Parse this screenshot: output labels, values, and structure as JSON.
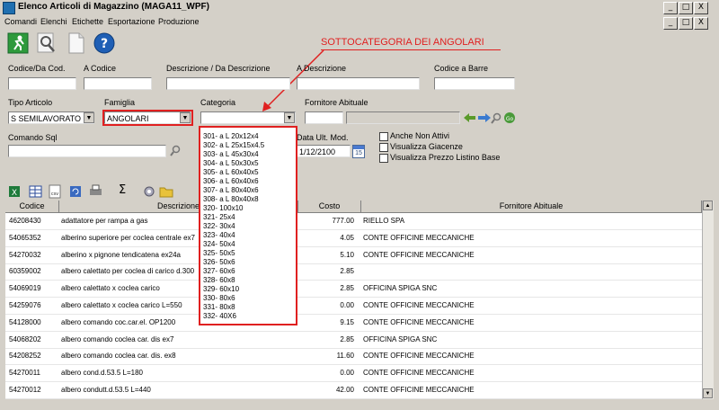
{
  "window": {
    "title": "Elenco Articoli di Magazzino (MAGA11_WPF)",
    "controls": [
      "_",
      "□",
      "X"
    ],
    "outer_controls": [
      "_",
      "□",
      "X"
    ]
  },
  "menu": [
    "Comandi",
    "Elenchi",
    "Etichette",
    "Esportazione",
    "Produzione"
  ],
  "toolbar": [
    {
      "icon": "exit-icon"
    },
    {
      "icon": "search-icon"
    },
    {
      "icon": "new-document-icon"
    },
    {
      "icon": "help-icon"
    }
  ],
  "annotation": {
    "text": "SOTTOCATEGORIA DEI ANGOLARI",
    "color": "#e02020"
  },
  "filters": {
    "codice_da_label": "Codice/Da Cod.",
    "codice_da_value": "",
    "a_codice_label": "A Codice",
    "a_codice_value": "",
    "descrizione_label": "Descrizione / Da Descrizione",
    "descrizione_value": "",
    "a_descrizione_label": "A Descrizione",
    "a_descrizione_value": "",
    "codice_barre_label": "Codice a Barre",
    "codice_barre_value": "",
    "tipo_articolo_label": "Tipo Articolo",
    "tipo_articolo_value": "S  SEMILAVORATO",
    "famiglia_label": "Famiglia",
    "famiglia_value": "ANGOLARI",
    "categoria_label": "Categoria",
    "categoria_value": "",
    "fornitore_label": "Fornitore Abituale",
    "fornitore_code": "",
    "fornitore_name": "",
    "comando_sql_label": "Comando Sql",
    "comando_sql_value": "",
    "data_ult_mod_label": "Data Ult. Mod.",
    "data_ult_mod_value": "1/12/2100",
    "calendar_day": "15",
    "checkboxes": [
      "Anche Non Attivi",
      "Visualizza Giacenze",
      "Visualizza Prezzo Listino Base"
    ]
  },
  "categoria_options": [
    "301- a L 20x12x4",
    "302- a L 25x15x4.5",
    "303- a L 45x30x4",
    "304- a L 50x30x5",
    "305- a L 60x40x5",
    "306- a L 60x40x6",
    "307- a L 80x40x6",
    "308- a L 80x40x8",
    "320-  100x10",
    "321-  25x4",
    "322-  30x4",
    "323-  40x4",
    "324-  50x4",
    "325-  50x5",
    "326-  50x6",
    "327-  60x6",
    "328-  60x8",
    "329-  60x10",
    "330-  80x6",
    "331-  80x8",
    "332-  40X6"
  ],
  "grid_toolbar": [
    "excel-icon",
    "table-icon",
    "csv-icon",
    "refresh-icon",
    "print-icon",
    "sum-icon",
    "settings-icon",
    "folder-icon"
  ],
  "sum_symbol": "Σ",
  "grid_columns": [
    "Codice",
    "Descrizione",
    "Costo",
    "Fornitore Abituale"
  ],
  "rows": [
    {
      "codice": "46208430",
      "descrizione": "adattatore per rampa a gas",
      "costo": "777.00",
      "fornitore": "RIELLO SPA"
    },
    {
      "codice": "54065352",
      "descrizione": "alberino superiore per coclea centrale ex7",
      "costo": "4.05",
      "fornitore": "CONTE OFFICINE MECCANICHE"
    },
    {
      "codice": "54270032",
      "descrizione": "alberino x pignone tendicatena ex24a",
      "costo": "5.10",
      "fornitore": "CONTE OFFICINE MECCANICHE"
    },
    {
      "codice": "60359002",
      "descrizione": "albero calettato per coclea di carico d.300",
      "costo": "2.85",
      "fornitore": ""
    },
    {
      "codice": "54069019",
      "descrizione": "albero calettato x coclea carico",
      "costo": "2.85",
      "fornitore": "OFFICINA SPIGA SNC"
    },
    {
      "codice": "54259076",
      "descrizione": "albero calettato x coclea carico L=550",
      "costo": "0.00",
      "fornitore": "CONTE OFFICINE MECCANICHE"
    },
    {
      "codice": "54128000",
      "descrizione": "albero comando coc.car.el. OP1200",
      "costo": "9.15",
      "fornitore": "CONTE OFFICINE MECCANICHE"
    },
    {
      "codice": "54068202",
      "descrizione": "albero comando coclea car. dis ex7",
      "costo": "2.85",
      "fornitore": "OFFICINA SPIGA SNC"
    },
    {
      "codice": "54208252",
      "descrizione": "albero comando coclea car. dis. ex8",
      "costo": "11.60",
      "fornitore": "CONTE OFFICINE MECCANICHE"
    },
    {
      "codice": "54270011",
      "descrizione": "albero cond.d.53.5 L=180",
      "costo": "0.00",
      "fornitore": "CONTE OFFICINE MECCANICHE"
    },
    {
      "codice": "54270012",
      "descrizione": "albero condutt.d.53.5 L=440",
      "costo": "42.00",
      "fornitore": "CONTE OFFICINE MECCANICHE"
    }
  ]
}
